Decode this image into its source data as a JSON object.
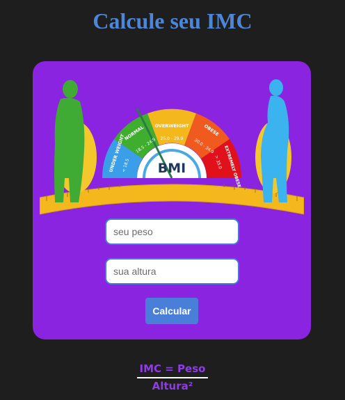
{
  "page": {
    "title": "Calcule seu IMC"
  },
  "illustration": {
    "center_label": "BMI",
    "categories": [
      {
        "name": "UNDER WEIGHT",
        "range": "< 18.5",
        "color": "#3a9ee8"
      },
      {
        "name": "NORMAL",
        "range": "18.5 - 24.9",
        "color": "#3fae2f"
      },
      {
        "name": "OVERWEIGHT",
        "range": "25.0 - 29.9",
        "color": "#f4b81c"
      },
      {
        "name": "OBESE",
        "range": "30.0 - 34.9",
        "color": "#f05a1e"
      },
      {
        "name": "EXTREMELY OBESE",
        "range": "> 35.0",
        "color": "#e0111b"
      }
    ],
    "figures": [
      {
        "name": "male-figure",
        "color": "#3faa34"
      },
      {
        "name": "female-figure",
        "color": "#3ab3ee"
      }
    ]
  },
  "form": {
    "weight_placeholder": "seu peso",
    "height_placeholder": "sua altura",
    "submit_label": "Calcular"
  },
  "formula": {
    "numerator": "IMC = Peso",
    "denominator": "Altura²"
  }
}
